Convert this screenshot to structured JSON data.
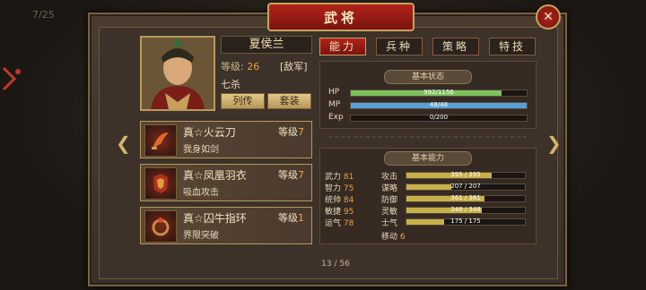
{
  "background": {
    "counter": "7/25"
  },
  "header": {
    "title": "武将",
    "close_icon": "close-icon"
  },
  "general": {
    "name": "夏侯兰",
    "level_label": "等级:",
    "level_value": "26",
    "faction": "[敌军]",
    "skill": "七杀",
    "bio_button": "列传",
    "outfit_button": "套装"
  },
  "tabs": [
    {
      "label": "能力",
      "active": true
    },
    {
      "label": "兵种",
      "active": false
    },
    {
      "label": "策略",
      "active": false
    },
    {
      "label": "特技",
      "active": false
    }
  ],
  "equipment": [
    {
      "name": "真☆火云刀",
      "level_label": "等级",
      "level": "7",
      "desc": "我身如剑",
      "icon": "sword-icon"
    },
    {
      "name": "真☆凤凰羽衣",
      "level_label": "等级",
      "level": "7",
      "desc": "吸血攻击",
      "icon": "armor-icon"
    },
    {
      "name": "真☆囚牛指环",
      "level_label": "等级",
      "level": "1",
      "desc": "界限突破",
      "icon": "ring-icon"
    }
  ],
  "basic_status": {
    "title": "基本状态",
    "hp": {
      "label": "HP",
      "text": "992/1156",
      "fill": 0.858,
      "color": "#7bc25a"
    },
    "mp": {
      "label": "MP",
      "text": "48/48",
      "fill": 1.0,
      "color": "#5aa0d8"
    },
    "exp": {
      "label": "Exp",
      "text": "0/200",
      "fill": 0.0,
      "color": "#c7b04a"
    }
  },
  "basic_ability": {
    "title": "基本能力",
    "attributes": [
      {
        "label": "武力",
        "value": "81"
      },
      {
        "label": "智力",
        "value": "75"
      },
      {
        "label": "统帅",
        "value": "84"
      },
      {
        "label": "敏捷",
        "value": "95"
      },
      {
        "label": "运气",
        "value": "78"
      }
    ],
    "combat": [
      {
        "label": "攻击",
        "text": "395 / 395",
        "fill": 0.72
      },
      {
        "label": "谋略",
        "text": "207 / 207",
        "fill": 0.38
      },
      {
        "label": "防御",
        "text": "361 / 361",
        "fill": 0.66
      },
      {
        "label": "灵敏",
        "text": "348 / 348",
        "fill": 0.64
      },
      {
        "label": "士气",
        "text": "175 / 175",
        "fill": 0.32
      }
    ],
    "move_label": "移动",
    "move_value": "6"
  },
  "pager": {
    "text": "13 / 56"
  }
}
